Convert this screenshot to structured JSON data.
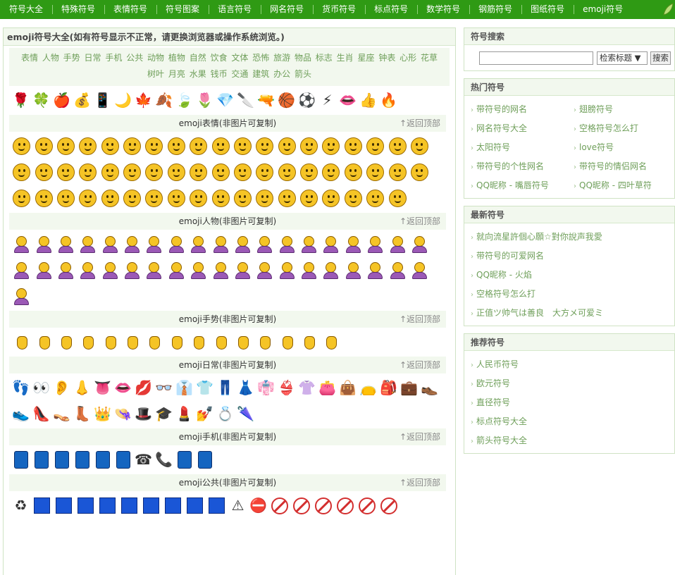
{
  "nav": [
    "符号大全",
    "特殊符号",
    "表情符号",
    "符号图案",
    "语言符号",
    "网名符号",
    "货币符号",
    "标点符号",
    "数学符号",
    "钢筋符号",
    "图纸符号",
    "emoji符号"
  ],
  "left": {
    "title": "emoji符号大全(如有符号显示不正常，请更换浏览器或操作系统浏览。)",
    "categories": [
      "表情",
      "人物",
      "手势",
      "日常",
      "手机",
      "公共",
      "动物",
      "植物",
      "自然",
      "饮食",
      "文体",
      "恐怖",
      "旅游",
      "物品",
      "标志",
      "生肖",
      "星座",
      "钟表",
      "心形",
      "花草",
      "树叶",
      "月亮",
      "水果",
      "钱币",
      "交通",
      "建筑",
      "办公",
      "箭头"
    ],
    "sample_icons": [
      "🌹",
      "🍀",
      "🍎",
      "💰",
      "📱",
      "🌙",
      "🍁",
      "🍂",
      "🍃",
      "🌷",
      "💎",
      "🔪",
      "🔫",
      "🏀",
      "⚽",
      "⚡",
      "👄",
      "👍",
      "🔥"
    ],
    "back_label": "↑返回顶部",
    "sections": [
      {
        "title": "emoji表情(非图片可复制)"
      },
      {
        "title": "emoji人物(非图片可复制)"
      },
      {
        "title": "emoji手势(非图片可复制)"
      },
      {
        "title": "emoji日常(非图片可复制)"
      },
      {
        "title": "emoji手机(非图片可复制)"
      },
      {
        "title": "emoji公共(非图片可复制)"
      }
    ],
    "daily_icons": [
      "👣",
      "👀",
      "👂",
      "👃",
      "👅",
      "👄",
      "💋",
      "👓",
      "👔",
      "👕",
      "👖",
      "👗",
      "👘",
      "👙",
      "👚",
      "👛",
      "👜",
      "👝",
      "🎒",
      "💼",
      "👞",
      "👟",
      "👠",
      "👡",
      "👢",
      "👑",
      "👒",
      "🎩",
      "🎓",
      "💄",
      "💅",
      "💍",
      "🌂"
    ],
    "phone_icons": [
      "☎",
      "📞"
    ],
    "public_icons": [
      "♻",
      "⚠",
      "⛔"
    ]
  },
  "right": {
    "search": {
      "title": "符号搜索",
      "input_value": "",
      "select_value": "检索标题 ▼",
      "button_label": "搜索"
    },
    "hot": {
      "title": "热门符号",
      "links": [
        "带符号的网名",
        "翅膀符号",
        "网名符号大全",
        "空格符号怎么打",
        "太阳符号",
        "love符号",
        "带符号的个性网名",
        "带符号的情侣网名",
        "QQ昵称 - 嘴唇符号",
        "QQ昵称 - 四叶草符"
      ]
    },
    "latest": {
      "title": "最新符号",
      "links": [
        "就向流星許個心願☆對你說声我愛",
        "带符号的可爱网名",
        "QQ昵称 - 火焰",
        "空格符号怎么打",
        "正值ツ帅气は善良　大方メ可爱ミ"
      ]
    },
    "recommend": {
      "title": "推荐符号",
      "links": [
        "人民币符号",
        "欧元符号",
        "直径符号",
        "标点符号大全",
        "箭头符号大全"
      ]
    }
  }
}
